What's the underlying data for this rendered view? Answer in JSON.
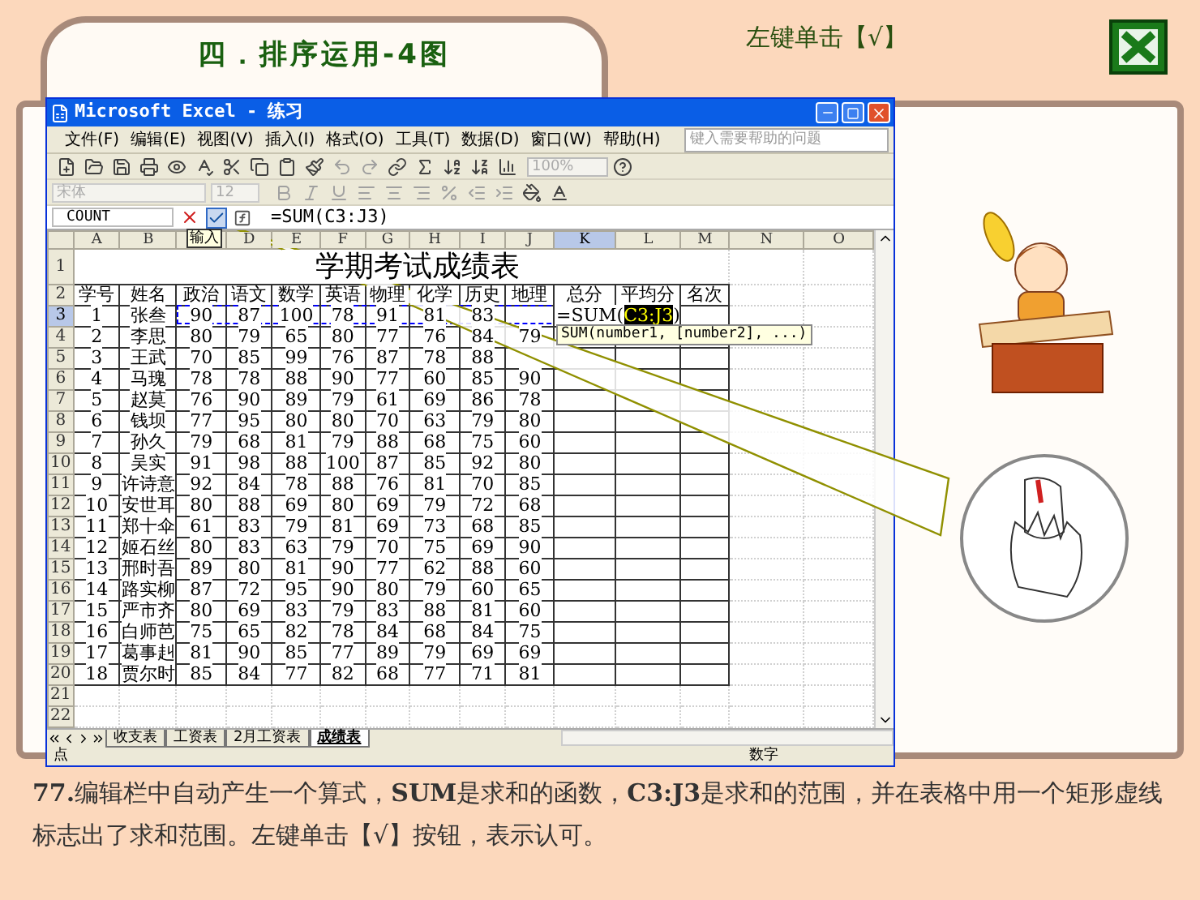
{
  "header": {
    "title": "四．排序运用-4图",
    "instruction": "左键单击【√】"
  },
  "excel": {
    "title": "Microsoft Excel - 练习",
    "menu": [
      "文件(F)",
      "编辑(E)",
      "视图(V)",
      "插入(I)",
      "格式(O)",
      "工具(T)",
      "数据(D)",
      "窗口(W)",
      "帮助(H)"
    ],
    "help_placeholder": "键入需要帮助的问题",
    "zoom_box": "100%",
    "font_box": "宋体",
    "size_box": "12",
    "name_box": "COUNT",
    "formula": "=SUM(C3:J3)",
    "enter_tooltip": "输入",
    "columns": [
      {
        "label": "A",
        "selected": false
      },
      {
        "label": "B",
        "selected": false
      },
      {
        "selected": false
      },
      {
        "label": "D",
        "selected": false
      },
      {
        "label": "E",
        "selected": false
      },
      {
        "label": "F",
        "selected": false
      },
      {
        "label": "G",
        "selected": false
      },
      {
        "label": "H",
        "selected": false
      },
      {
        "label": "I",
        "selected": false
      },
      {
        "label": "J",
        "selected": false
      },
      {
        "label": "K",
        "selected": true
      },
      {
        "label": "L",
        "selected": false
      },
      {
        "label": "M",
        "selected": false
      },
      {
        "label": "N",
        "selected": false
      },
      {
        "label": "O",
        "selected": false
      }
    ],
    "row_numbers": [
      {
        "label": "1",
        "selected": false
      },
      {
        "label": "2",
        "selected": false
      },
      {
        "label": "3",
        "selected": true
      },
      {
        "label": "4",
        "selected": false
      },
      {
        "label": "5",
        "selected": false
      },
      {
        "label": "6",
        "selected": false
      },
      {
        "label": "7",
        "selected": false
      },
      {
        "label": "8",
        "selected": false
      },
      {
        "label": "9",
        "selected": false
      },
      {
        "label": "10",
        "selected": false
      },
      {
        "label": "11",
        "selected": false
      },
      {
        "label": "12",
        "selected": false
      },
      {
        "label": "13",
        "selected": false
      },
      {
        "label": "14",
        "selected": false
      },
      {
        "label": "15",
        "selected": false
      },
      {
        "label": "16",
        "selected": false
      },
      {
        "label": "17",
        "selected": false
      },
      {
        "label": "18",
        "selected": false
      },
      {
        "label": "19",
        "selected": false
      },
      {
        "label": "20",
        "selected": false
      },
      {
        "label": "21",
        "selected": false
      },
      {
        "label": "22",
        "selected": false
      }
    ],
    "sheet_title": "学期考试成绩表",
    "table_header": [
      "学号",
      "姓名",
      "政治",
      "语文",
      "数学",
      "英语",
      "物理",
      "化学",
      "历史",
      "地理",
      "总分",
      "平均分",
      "名次"
    ],
    "rows": [
      {
        "cells": [
          "1",
          "张叁",
          "90",
          "87",
          "100",
          "78",
          "91",
          "81",
          "83"
        ],
        "formula_cell": {
          "prefix": "=SUM(",
          "range": "C3:J3",
          "suffix": ")"
        }
      },
      {
        "cells": [
          "2",
          "李思",
          "80",
          "79",
          "65",
          "80",
          "77",
          "76",
          "84",
          "79"
        ]
      },
      {
        "cells": [
          "3",
          "王武",
          "70",
          "85",
          "99",
          "76",
          "87",
          "78",
          "88"
        ]
      },
      {
        "cells": [
          "4",
          "马瑰",
          "78",
          "78",
          "88",
          "90",
          "77",
          "60",
          "85",
          "90"
        ]
      },
      {
        "cells": [
          "5",
          "赵莫",
          "76",
          "90",
          "89",
          "79",
          "61",
          "69",
          "86",
          "78"
        ]
      },
      {
        "cells": [
          "6",
          "钱坝",
          "77",
          "95",
          "80",
          "80",
          "70",
          "63",
          "79",
          "80"
        ]
      },
      {
        "cells": [
          "7",
          "孙久",
          "79",
          "68",
          "81",
          "79",
          "88",
          "68",
          "75",
          "60"
        ]
      },
      {
        "cells": [
          "8",
          "吴实",
          "91",
          "98",
          "88",
          "100",
          "87",
          "85",
          "92",
          "80"
        ]
      },
      {
        "cells": [
          "9",
          "许诗意",
          "92",
          "84",
          "78",
          "88",
          "76",
          "81",
          "70",
          "85"
        ]
      },
      {
        "cells": [
          "10",
          "安世耳",
          "80",
          "88",
          "69",
          "80",
          "69",
          "79",
          "72",
          "68"
        ]
      },
      {
        "cells": [
          "11",
          "郑十伞",
          "61",
          "83",
          "79",
          "81",
          "69",
          "73",
          "68",
          "85"
        ]
      },
      {
        "cells": [
          "12",
          "姬石丝",
          "80",
          "83",
          "63",
          "79",
          "70",
          "75",
          "69",
          "90"
        ]
      },
      {
        "cells": [
          "13",
          "邢时吾",
          "89",
          "80",
          "81",
          "90",
          "77",
          "62",
          "88",
          "60"
        ]
      },
      {
        "cells": [
          "14",
          "路实柳",
          "87",
          "72",
          "95",
          "90",
          "80",
          "79",
          "60",
          "65"
        ]
      },
      {
        "cells": [
          "15",
          "严市齐",
          "80",
          "69",
          "83",
          "79",
          "83",
          "88",
          "81",
          "60"
        ]
      },
      {
        "cells": [
          "16",
          "白师芭",
          "75",
          "65",
          "82",
          "78",
          "84",
          "68",
          "84",
          "75"
        ]
      },
      {
        "cells": [
          "17",
          "葛事赳",
          "81",
          "90",
          "85",
          "77",
          "89",
          "79",
          "69",
          "69"
        ]
      },
      {
        "cells": [
          "18",
          "贾尔时",
          "85",
          "84",
          "77",
          "82",
          "68",
          "77",
          "71",
          "81"
        ]
      }
    ],
    "formula_hint": "SUM(number1, [number2], ...)",
    "sheets": [
      {
        "label": "收支表",
        "selected": false
      },
      {
        "label": "工资表",
        "selected": false
      },
      {
        "label": "2月工资表",
        "selected": false
      },
      {
        "label": "成绩表",
        "selected": true
      }
    ],
    "status_mode": "点",
    "status_num": "数字"
  },
  "caption": "**77.**编辑栏中自动产生一个算式，**SUM**是求和的函数，**C3:J3**是求和的范围，并在表格中用一个矩形虚线标志出了求和范围。左键单击【√】按钮，表示认可。"
}
